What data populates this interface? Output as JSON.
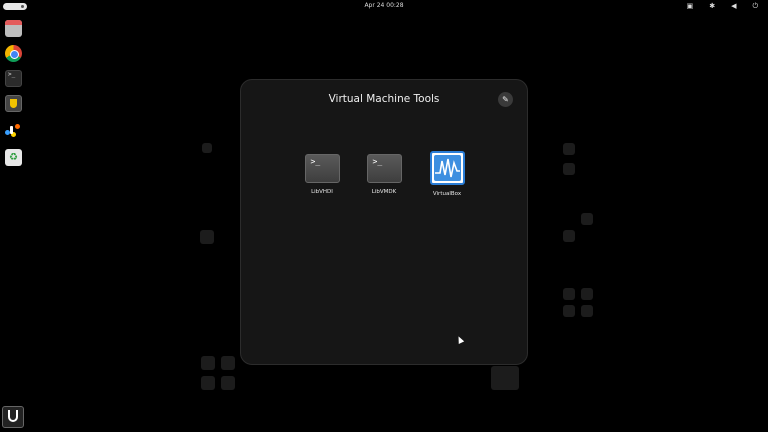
{
  "topbar": {
    "clock": "Apr 24  00:28",
    "tray_icons": [
      "network-icon",
      "bluetooth-icon",
      "volume-icon",
      "power-icon"
    ]
  },
  "folder": {
    "title": "Virtual Machine Tools",
    "edit_icon": "pencil-icon",
    "apps": [
      {
        "label": "LibVHDI",
        "icon": "terminal-icon"
      },
      {
        "label": "LibVMDK",
        "icon": "terminal-icon"
      },
      {
        "label": "VirtualBox",
        "icon": "virtualbox-icon"
      }
    ]
  },
  "dock": {
    "items": [
      "files-icon",
      "chrome-icon",
      "terminal-icon",
      "security-icon",
      "paint-icon",
      "trash-icon",
      "bitwarden-icon"
    ]
  },
  "colors": {
    "background": "#000000",
    "folder_bg": "#161616",
    "accent": "#2a7dd6"
  }
}
